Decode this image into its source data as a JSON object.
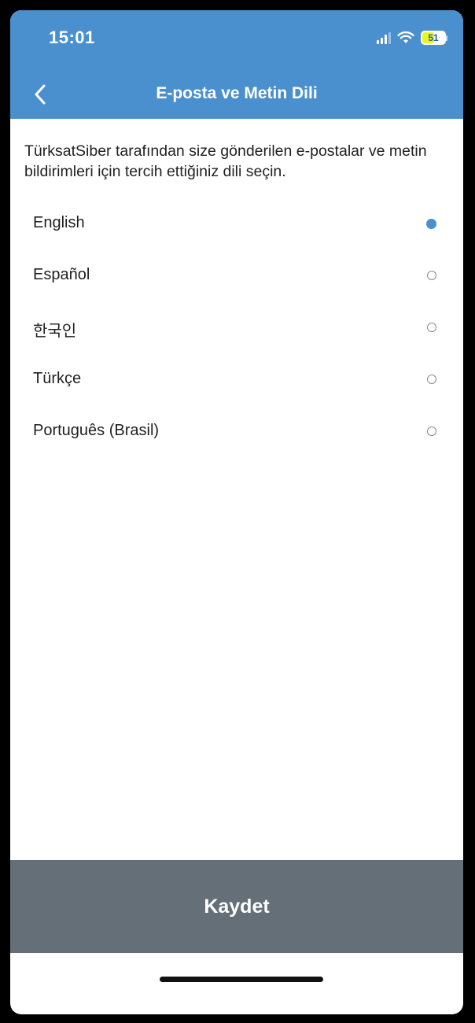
{
  "status_bar": {
    "time": "15:01",
    "battery": "51"
  },
  "header": {
    "title": "E-posta ve Metin Dili"
  },
  "description": "TürksatSiber tarafından size gönderilen e-postalar ve metin bildirimleri için tercih ettiğiniz dili seçin.",
  "languages": [
    {
      "label": "English",
      "selected": true
    },
    {
      "label": "Español",
      "selected": false
    },
    {
      "label": "한국인",
      "selected": false
    },
    {
      "label": "Türkçe",
      "selected": false
    },
    {
      "label": "Português (Brasil)",
      "selected": false
    }
  ],
  "save_button": {
    "label": "Kaydet"
  },
  "colors": {
    "accent": "#4a90ce",
    "button": "#646f77"
  }
}
